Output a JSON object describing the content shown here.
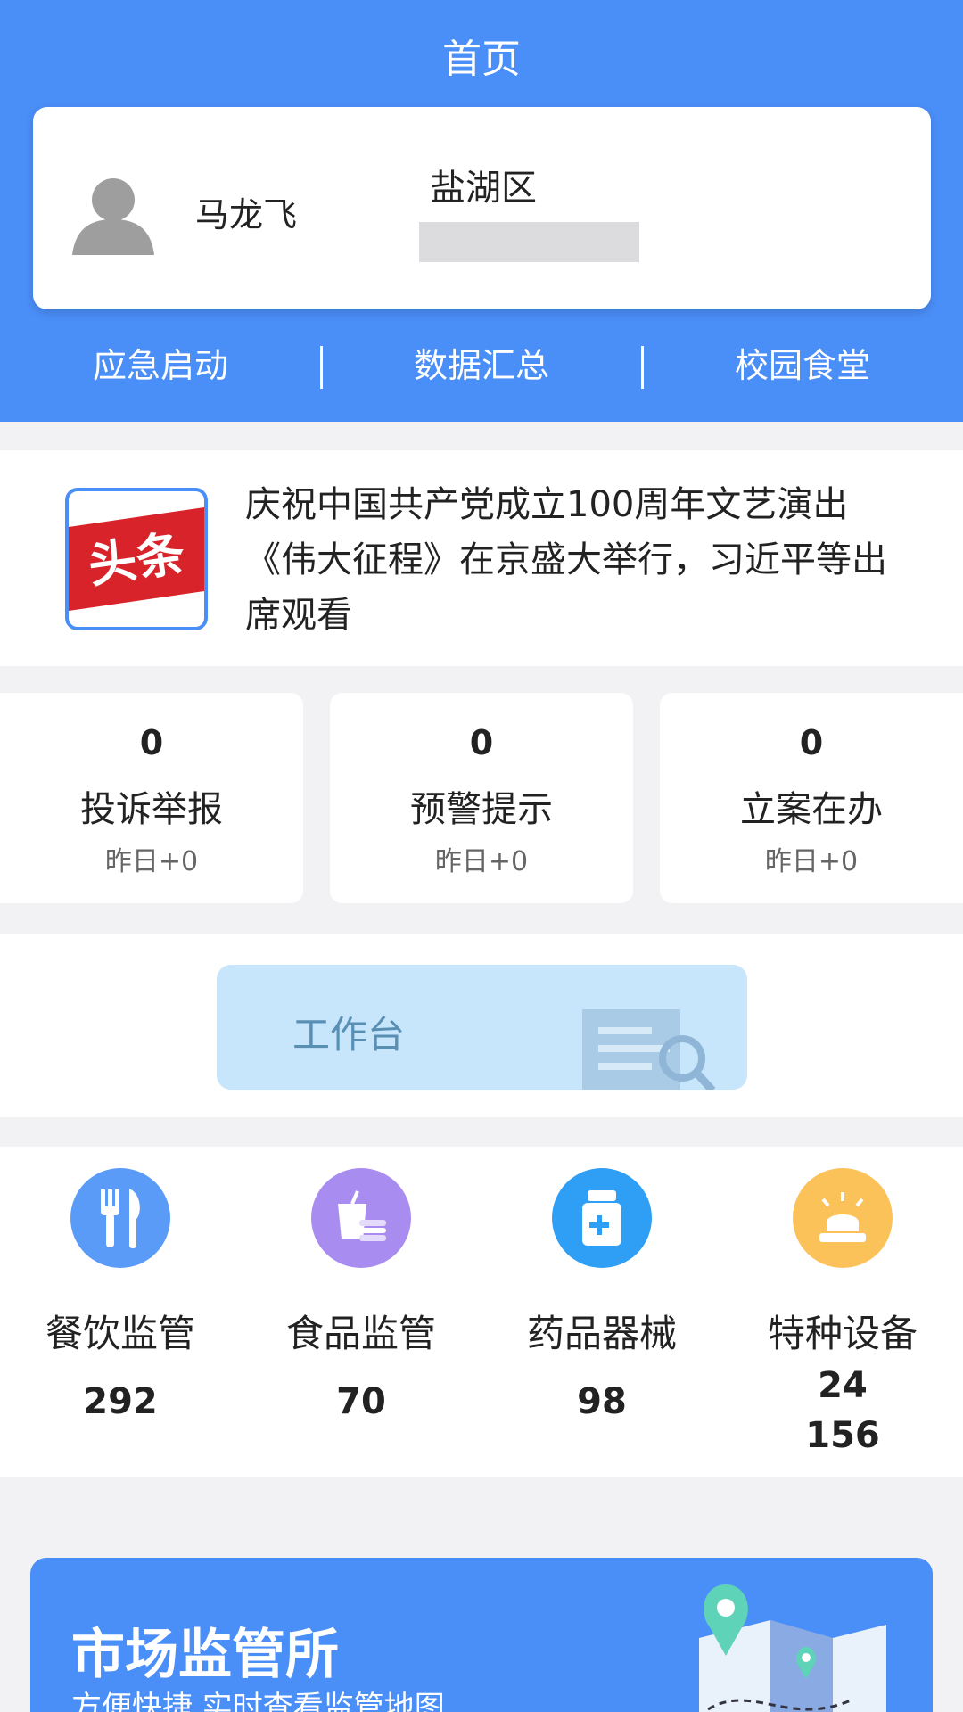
{
  "header": {
    "title": "首页"
  },
  "profile": {
    "name": "马龙飞",
    "district": "盐湖区"
  },
  "quick_nav": [
    {
      "label": "应急启动"
    },
    {
      "label": "数据汇总"
    },
    {
      "label": "校园食堂"
    }
  ],
  "news": {
    "badge": "头条",
    "headline": "庆祝中国共产党成立100周年文艺演出《伟大征程》在京盛大举行，习近平等出席观看"
  },
  "stats": [
    {
      "value": "0",
      "label": "投诉举报",
      "sub": "昨日+0"
    },
    {
      "value": "0",
      "label": "预警提示",
      "sub": "昨日+0"
    },
    {
      "value": "0",
      "label": "立案在办",
      "sub": "昨日+0"
    }
  ],
  "workbench": {
    "label": "工作台"
  },
  "categories": [
    {
      "name": "餐饮监管",
      "value": "292",
      "icon": "utensils-icon",
      "color": "#5b9bf8"
    },
    {
      "name": "食品监管",
      "value": "70",
      "icon": "drink-burger-icon",
      "color": "#a98cf0"
    },
    {
      "name": "药品器械",
      "value": "98",
      "icon": "medicine-bottle-icon",
      "color": "#2e9ff5"
    },
    {
      "name": "特种设备",
      "value": "24",
      "value2": "156",
      "icon": "alarm-light-icon",
      "color": "#fbc25a"
    }
  ],
  "banner": {
    "title": "市场监管所",
    "subtitle": "方便快捷 实时查看监管地图"
  },
  "colors": {
    "primary": "#4a8ef8",
    "page_bg": "#f2f2f5"
  }
}
